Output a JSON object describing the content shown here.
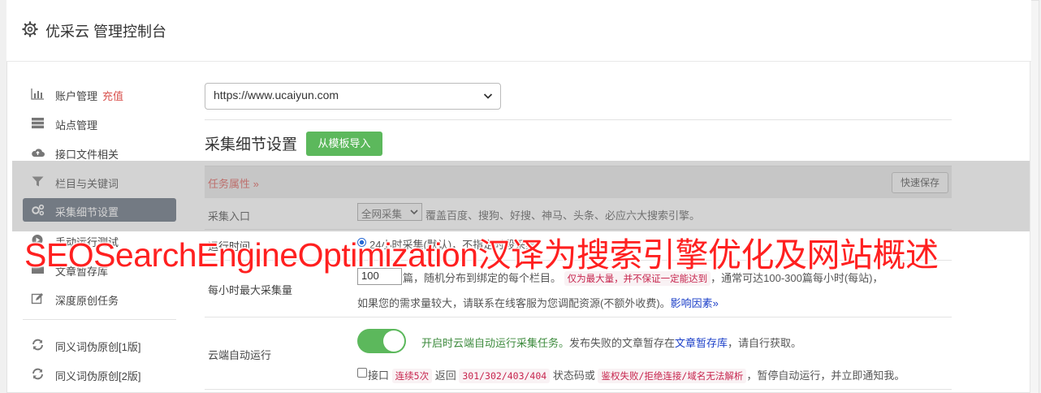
{
  "header": {
    "title": "优采云 管理控制台"
  },
  "sidebar": {
    "items": [
      {
        "label": "账户管理",
        "extra": "充值",
        "icon": "bar-chart-icon"
      },
      {
        "label": "站点管理",
        "icon": "server-icon"
      },
      {
        "label": "接口文件相关",
        "icon": "cloud-upload-icon"
      },
      {
        "label": "栏目与关键词",
        "icon": "filter-icon"
      },
      {
        "label": "采集细节设置",
        "icon": "gears-icon",
        "active": true
      },
      {
        "label": "手动运行测试",
        "icon": "play-icon"
      },
      {
        "label": "文章暂存库",
        "icon": "folder-icon"
      },
      {
        "label": "深度原创任务",
        "icon": "edit-icon"
      },
      {
        "label": "同义词伪原创[1版]",
        "icon": "refresh-icon"
      },
      {
        "label": "同义词伪原创[2版]",
        "icon": "refresh-icon"
      }
    ]
  },
  "site_select": {
    "value": "https://www.ucaiyun.com"
  },
  "section": {
    "title": "采集细节设置",
    "import_button": "从模板导入"
  },
  "task_attr": {
    "label": "任务属性 »",
    "quick_save": "快速保存"
  },
  "collect_entry": {
    "label": "采集入口",
    "select_value": "全网采集",
    "desc": "覆盖百度、搜狗、好搜、神马、头条、必应六大搜索引擎。"
  },
  "run_time": {
    "label": "运行时间",
    "option": "24小时采集(默认)，不指定时段采集"
  },
  "max_per_hour": {
    "label": "每小时最大采集量",
    "value": "100",
    "text1": "篇，随机分布到绑定的每个栏目。",
    "pill": "仅为最大量，并不保证一定能达到",
    "text2": "，通常可达100-300篇每小时(每站)，",
    "text3": "如果您的需求量较大，请联系在线客服为您调配资源(不额外收费)。",
    "link": "影响因素»"
  },
  "cloud_run": {
    "label": "云端自动运行",
    "green_text": "开启时云端自动运行采集任务。",
    "text": "发布失败的文章暂存在",
    "link": "文章暂存库",
    "text_end": "，请自行获取。",
    "check_pre": "接口",
    "pill1": "连续5次",
    "mid1": "返回",
    "pill2": "301/302/403/404",
    "mid2": "状态码或",
    "pill3": "鉴权失败/拒绝连接/域名无法解析",
    "mid3": "，暂停自动运行，并立即通知我。"
  },
  "banner": {
    "text": "SEOSearchEngineOptimization汉译为搜索引擎优化及网站概述"
  },
  "colors": {
    "accent_green": "#5cb85c",
    "active_sidebar": "#5b6676",
    "banner_red": "#ff2020",
    "pill_red": "#c7254e"
  }
}
